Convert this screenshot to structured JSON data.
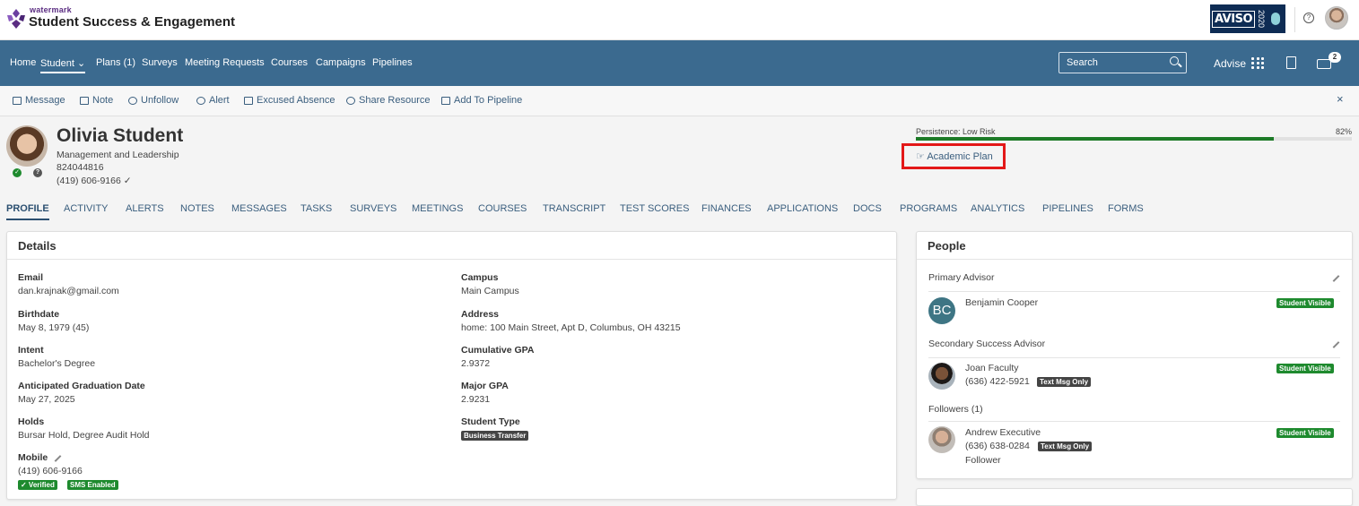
{
  "app": {
    "brand_small": "watermark",
    "brand_main": "Student Success & Engagement"
  },
  "header_right": {
    "conf_badge": "AVISO",
    "conf_year": "2020"
  },
  "nav": {
    "items": [
      "Home",
      "Student",
      "Plans (1)",
      "Surveys",
      "Meeting Requests",
      "Courses",
      "Campaigns",
      "Pipelines"
    ],
    "active": "Student",
    "search_placeholder": "Search",
    "advise_label": "Advise",
    "inbox_count": "2"
  },
  "actions": [
    "Message",
    "Note",
    "Unfollow",
    "Alert",
    "Excused Absence",
    "Share Resource",
    "Add To Pipeline"
  ],
  "close_label": "×",
  "student": {
    "name": "Olivia Student",
    "program": "Management and Leadership",
    "id": "824044816",
    "phone": "(419) 606-9166 ✓"
  },
  "persistence": {
    "label": "Persistence: Low Risk",
    "percent_label": "82%",
    "value": 0.82,
    "color": "#1d7a27"
  },
  "academic_plan_label": "Academic Plan",
  "tabs": [
    "PROFILE",
    "ACTIVITY",
    "ALERTS",
    "NOTES",
    "MESSAGES",
    "TASKS",
    "SURVEYS",
    "MEETINGS",
    "COURSES",
    "TRANSCRIPT",
    "TEST SCORES",
    "FINANCES",
    "APPLICATIONS",
    "DOCS",
    "PROGRAMS",
    "ANALYTICS",
    "PIPELINES",
    "FORMS"
  ],
  "details": {
    "title": "Details",
    "left": [
      {
        "label": "Email",
        "value": "dan.krajnak@gmail.com"
      },
      {
        "label": "Birthdate",
        "value": "May 8, 1979 (45)"
      },
      {
        "label": "Intent",
        "value": "Bachelor's Degree"
      },
      {
        "label": "Anticipated Graduation Date",
        "value": "May 27, 2025"
      },
      {
        "label": "Holds",
        "value": "Bursar Hold, Degree Audit Hold"
      },
      {
        "label": "Mobile",
        "value": "(419) 606-9166"
      }
    ],
    "right": [
      {
        "label": "Campus",
        "value": "Main Campus"
      },
      {
        "label": "Address",
        "value": "home: 100 Main Street, Apt D, Columbus, OH 43215"
      },
      {
        "label": "Cumulative GPA",
        "value": "2.9372"
      },
      {
        "label": "Major GPA",
        "value": "2.9231"
      },
      {
        "label": "Student Type",
        "value": "Business Transfer"
      }
    ],
    "mobile_badges": [
      "✓ Verified",
      "SMS Enabled"
    ]
  },
  "people": {
    "title": "People",
    "primary_label": "Primary Advisor",
    "primary": {
      "initials": "BC",
      "name": "Benjamin Cooper",
      "badge": "Student Visible"
    },
    "secondary_label": "Secondary Success Advisor",
    "secondary": {
      "name": "Joan Faculty",
      "phone": "(636) 422-5921",
      "tag": "Text Msg Only",
      "badge": "Student Visible"
    },
    "followers_label": "Followers (1)",
    "follower": {
      "name": "Andrew Executive",
      "phone": "(636) 638-0284",
      "tag": "Text Msg Only",
      "role": "Follower",
      "badge": "Student Visible"
    }
  },
  "colors": {
    "nav_bg": "#3b6a8f",
    "highlight_border": "#e31818",
    "visible_badge": "#1e8a2e"
  }
}
